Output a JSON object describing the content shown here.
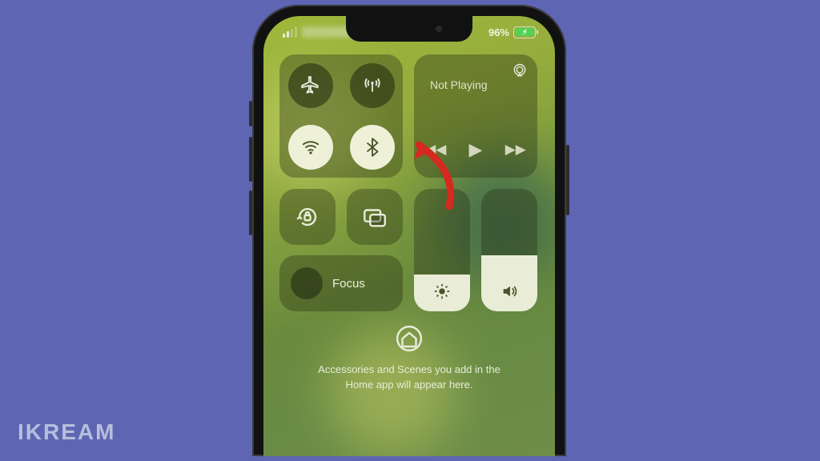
{
  "watermark": "IKREAM",
  "status": {
    "battery_pct": "96%"
  },
  "connectivity": {
    "airplane": false,
    "cellular": true,
    "wifi": true,
    "bluetooth": true
  },
  "media": {
    "now_playing": "Not Playing"
  },
  "focus": {
    "label": "Focus"
  },
  "sliders": {
    "brightness_pct": 30,
    "volume_pct": 46
  },
  "home": {
    "message_l1": "Accessories and Scenes you add in the",
    "message_l2": "Home app will appear here."
  }
}
